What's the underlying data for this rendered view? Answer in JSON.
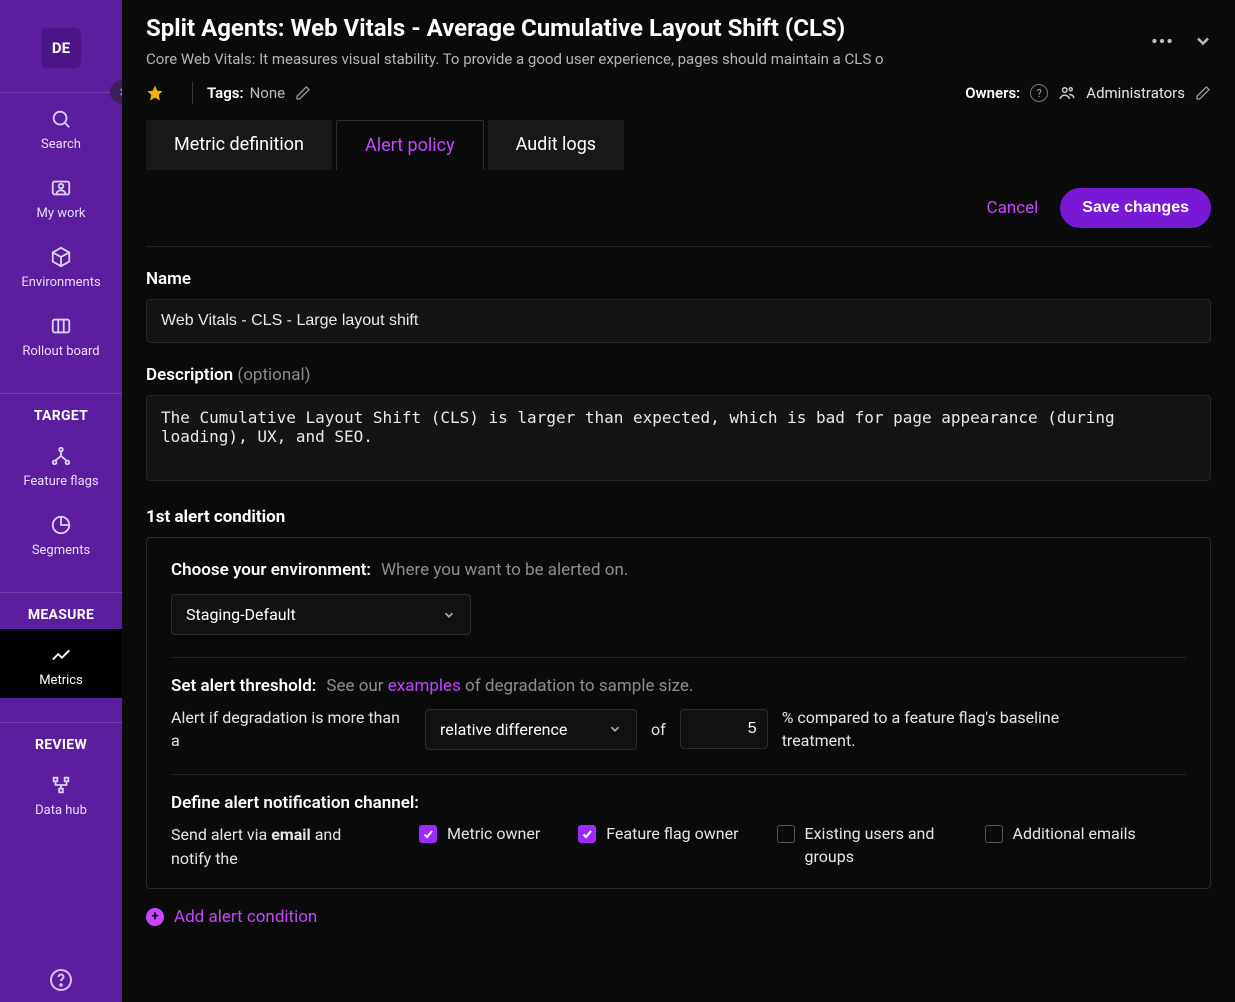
{
  "workspace_badge": "DE",
  "sidebar": {
    "items": [
      {
        "label": "Search"
      },
      {
        "label": "My work"
      },
      {
        "label": "Environments"
      },
      {
        "label": "Rollout board"
      }
    ],
    "target_heading": "TARGET",
    "target_items": [
      {
        "label": "Feature flags"
      },
      {
        "label": "Segments"
      }
    ],
    "measure_heading": "MEASURE",
    "measure_items": [
      {
        "label": "Metrics"
      }
    ],
    "review_heading": "REVIEW",
    "review_items": [
      {
        "label": "Data hub"
      }
    ]
  },
  "header": {
    "title": "Split Agents: Web Vitals - Average Cumulative Layout Shift (CLS)",
    "subtitle": "Core Web Vitals: It measures visual stability. To provide a good user experience, pages should maintain a CLS o"
  },
  "meta": {
    "tags_label": "Tags:",
    "tags_value": "None",
    "owners_label": "Owners:",
    "owners_value": "Administrators"
  },
  "tabs": [
    {
      "label": "Metric definition"
    },
    {
      "label": "Alert policy"
    },
    {
      "label": "Audit logs"
    }
  ],
  "actions": {
    "cancel": "Cancel",
    "save": "Save changes"
  },
  "form": {
    "name_label": "Name",
    "name_value": "Web Vitals - CLS - Large layout shift",
    "desc_label": "Description",
    "desc_optional": "(optional)",
    "desc_value": "The Cumulative Layout Shift (CLS) is larger than expected, which is bad for page appearance (during loading), UX, and SEO."
  },
  "condition": {
    "title": "1st alert condition",
    "env_label": "Choose your environment:",
    "env_hint": "Where you want to be alerted on.",
    "env_value": "Staging-Default",
    "threshold_label": "Set alert threshold:",
    "threshold_hint_pre": "See our ",
    "threshold_hint_link": "examples",
    "threshold_hint_post": " of degradation to sample size.",
    "threshold_text_pre": "Alert if degradation is more than a",
    "threshold_mode": "relative difference",
    "threshold_of": "of",
    "threshold_value": "5",
    "threshold_text_post": "% compared to a feature flag's baseline treatment.",
    "notify_label": "Define alert notification channel:",
    "notify_lead_pre": "Send alert via ",
    "notify_lead_bold": "email",
    "notify_lead_post": " and notify the",
    "checks": [
      {
        "label": "Metric owner",
        "checked": true
      },
      {
        "label": "Feature flag owner",
        "checked": true
      },
      {
        "label": "Existing users and groups",
        "checked": false
      },
      {
        "label": "Additional emails",
        "checked": false
      }
    ]
  },
  "add_condition": "Add alert condition"
}
